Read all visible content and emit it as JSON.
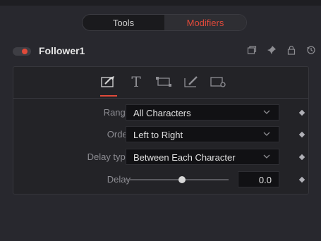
{
  "tabs": [
    {
      "label": "Tools",
      "active": false
    },
    {
      "label": "Modifiers",
      "active": true
    }
  ],
  "node": {
    "title": "Follower1",
    "enabled": true,
    "header_icons": [
      "version-icon",
      "pin-icon",
      "lock-icon",
      "reset-icon"
    ]
  },
  "inspector": {
    "icon_strip": [
      {
        "name": "timing-icon",
        "active": true
      },
      {
        "name": "text-icon",
        "active": false
      },
      {
        "name": "transform-icon",
        "active": false
      },
      {
        "name": "shading-icon",
        "active": false
      },
      {
        "name": "settings-icon",
        "active": false
      }
    ],
    "rows": {
      "range": {
        "label": "Range",
        "value": "All Characters"
      },
      "order": {
        "label": "Order",
        "value": "Left to Right"
      },
      "delay_type": {
        "label": "Delay type",
        "value": "Between Each Character"
      },
      "delay": {
        "label": "Delay",
        "value": "0.0",
        "slider_fraction": 0.55
      }
    }
  },
  "colors": {
    "accent": "#e04a3a",
    "background": "#28282e",
    "panel": "#232327",
    "field": "#111114"
  }
}
